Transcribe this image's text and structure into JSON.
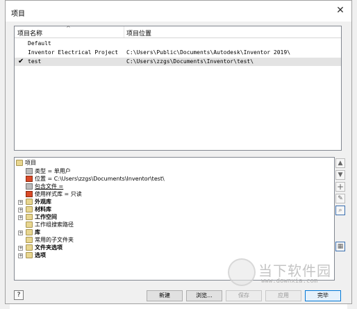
{
  "window": {
    "title": "项目"
  },
  "project_list": {
    "col_name": "项目名称",
    "col_location": "项目位置",
    "rows": [
      {
        "name": "Default",
        "location": "",
        "active": false
      },
      {
        "name": "Inventor Electrical Project",
        "location": "C:\\Users\\Public\\Documents\\Autodesk\\Inventor 2019\\",
        "active": false
      },
      {
        "name": "test",
        "location": "C:\\Users\\zzgs\\Documents\\Inventor\\test\\",
        "active": true
      }
    ]
  },
  "tree": {
    "root": "项目",
    "items": [
      {
        "label": "类型 = 单用户"
      },
      {
        "label": "位置 = C:\\Users\\zzgs\\Documents\\Inventor\\test\\"
      },
      {
        "label": "包含文件 ="
      },
      {
        "label": "使用样式库 = 只读"
      },
      {
        "label": "外观库"
      },
      {
        "label": "材料库"
      },
      {
        "label": "工作空间"
      },
      {
        "label": "工作组搜索路径"
      },
      {
        "label": "库"
      },
      {
        "label": "常用的子文件夹"
      },
      {
        "label": "文件夹选项"
      },
      {
        "label": "选项"
      }
    ]
  },
  "buttons": {
    "new": "新建",
    "browse": "浏览...",
    "save": "保存",
    "apply": "应用",
    "done": "完毕",
    "help": "?"
  },
  "watermark": {
    "text": "当下软件园",
    "url": "www.downxia.com"
  }
}
